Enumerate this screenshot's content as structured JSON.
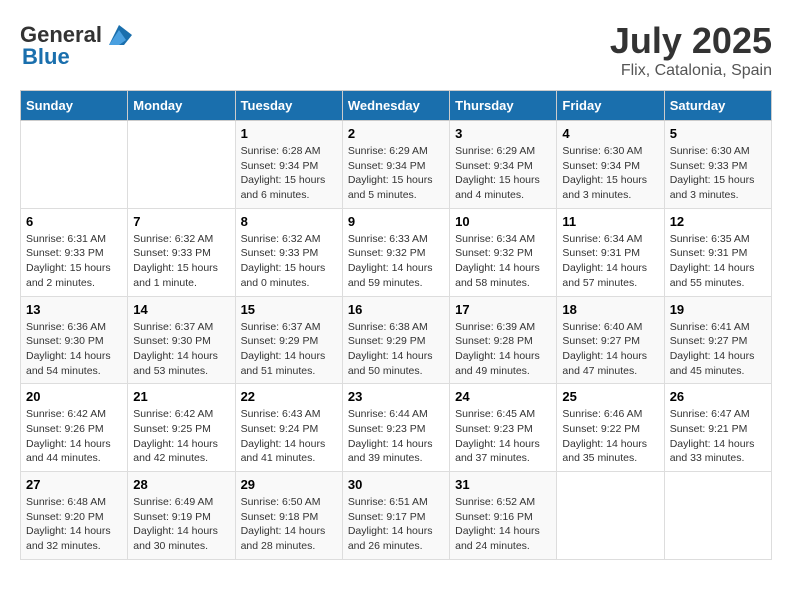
{
  "header": {
    "logo_general": "General",
    "logo_blue": "Blue",
    "title": "July 2025",
    "subtitle": "Flix, Catalonia, Spain"
  },
  "days_of_week": [
    "Sunday",
    "Monday",
    "Tuesday",
    "Wednesday",
    "Thursday",
    "Friday",
    "Saturday"
  ],
  "weeks": [
    [
      {
        "day": "",
        "sunrise": "",
        "sunset": "",
        "daylight": ""
      },
      {
        "day": "",
        "sunrise": "",
        "sunset": "",
        "daylight": ""
      },
      {
        "day": "1",
        "sunrise": "Sunrise: 6:28 AM",
        "sunset": "Sunset: 9:34 PM",
        "daylight": "Daylight: 15 hours and 6 minutes."
      },
      {
        "day": "2",
        "sunrise": "Sunrise: 6:29 AM",
        "sunset": "Sunset: 9:34 PM",
        "daylight": "Daylight: 15 hours and 5 minutes."
      },
      {
        "day": "3",
        "sunrise": "Sunrise: 6:29 AM",
        "sunset": "Sunset: 9:34 PM",
        "daylight": "Daylight: 15 hours and 4 minutes."
      },
      {
        "day": "4",
        "sunrise": "Sunrise: 6:30 AM",
        "sunset": "Sunset: 9:34 PM",
        "daylight": "Daylight: 15 hours and 3 minutes."
      },
      {
        "day": "5",
        "sunrise": "Sunrise: 6:30 AM",
        "sunset": "Sunset: 9:33 PM",
        "daylight": "Daylight: 15 hours and 3 minutes."
      }
    ],
    [
      {
        "day": "6",
        "sunrise": "Sunrise: 6:31 AM",
        "sunset": "Sunset: 9:33 PM",
        "daylight": "Daylight: 15 hours and 2 minutes."
      },
      {
        "day": "7",
        "sunrise": "Sunrise: 6:32 AM",
        "sunset": "Sunset: 9:33 PM",
        "daylight": "Daylight: 15 hours and 1 minute."
      },
      {
        "day": "8",
        "sunrise": "Sunrise: 6:32 AM",
        "sunset": "Sunset: 9:33 PM",
        "daylight": "Daylight: 15 hours and 0 minutes."
      },
      {
        "day": "9",
        "sunrise": "Sunrise: 6:33 AM",
        "sunset": "Sunset: 9:32 PM",
        "daylight": "Daylight: 14 hours and 59 minutes."
      },
      {
        "day": "10",
        "sunrise": "Sunrise: 6:34 AM",
        "sunset": "Sunset: 9:32 PM",
        "daylight": "Daylight: 14 hours and 58 minutes."
      },
      {
        "day": "11",
        "sunrise": "Sunrise: 6:34 AM",
        "sunset": "Sunset: 9:31 PM",
        "daylight": "Daylight: 14 hours and 57 minutes."
      },
      {
        "day": "12",
        "sunrise": "Sunrise: 6:35 AM",
        "sunset": "Sunset: 9:31 PM",
        "daylight": "Daylight: 14 hours and 55 minutes."
      }
    ],
    [
      {
        "day": "13",
        "sunrise": "Sunrise: 6:36 AM",
        "sunset": "Sunset: 9:30 PM",
        "daylight": "Daylight: 14 hours and 54 minutes."
      },
      {
        "day": "14",
        "sunrise": "Sunrise: 6:37 AM",
        "sunset": "Sunset: 9:30 PM",
        "daylight": "Daylight: 14 hours and 53 minutes."
      },
      {
        "day": "15",
        "sunrise": "Sunrise: 6:37 AM",
        "sunset": "Sunset: 9:29 PM",
        "daylight": "Daylight: 14 hours and 51 minutes."
      },
      {
        "day": "16",
        "sunrise": "Sunrise: 6:38 AM",
        "sunset": "Sunset: 9:29 PM",
        "daylight": "Daylight: 14 hours and 50 minutes."
      },
      {
        "day": "17",
        "sunrise": "Sunrise: 6:39 AM",
        "sunset": "Sunset: 9:28 PM",
        "daylight": "Daylight: 14 hours and 49 minutes."
      },
      {
        "day": "18",
        "sunrise": "Sunrise: 6:40 AM",
        "sunset": "Sunset: 9:27 PM",
        "daylight": "Daylight: 14 hours and 47 minutes."
      },
      {
        "day": "19",
        "sunrise": "Sunrise: 6:41 AM",
        "sunset": "Sunset: 9:27 PM",
        "daylight": "Daylight: 14 hours and 45 minutes."
      }
    ],
    [
      {
        "day": "20",
        "sunrise": "Sunrise: 6:42 AM",
        "sunset": "Sunset: 9:26 PM",
        "daylight": "Daylight: 14 hours and 44 minutes."
      },
      {
        "day": "21",
        "sunrise": "Sunrise: 6:42 AM",
        "sunset": "Sunset: 9:25 PM",
        "daylight": "Daylight: 14 hours and 42 minutes."
      },
      {
        "day": "22",
        "sunrise": "Sunrise: 6:43 AM",
        "sunset": "Sunset: 9:24 PM",
        "daylight": "Daylight: 14 hours and 41 minutes."
      },
      {
        "day": "23",
        "sunrise": "Sunrise: 6:44 AM",
        "sunset": "Sunset: 9:23 PM",
        "daylight": "Daylight: 14 hours and 39 minutes."
      },
      {
        "day": "24",
        "sunrise": "Sunrise: 6:45 AM",
        "sunset": "Sunset: 9:23 PM",
        "daylight": "Daylight: 14 hours and 37 minutes."
      },
      {
        "day": "25",
        "sunrise": "Sunrise: 6:46 AM",
        "sunset": "Sunset: 9:22 PM",
        "daylight": "Daylight: 14 hours and 35 minutes."
      },
      {
        "day": "26",
        "sunrise": "Sunrise: 6:47 AM",
        "sunset": "Sunset: 9:21 PM",
        "daylight": "Daylight: 14 hours and 33 minutes."
      }
    ],
    [
      {
        "day": "27",
        "sunrise": "Sunrise: 6:48 AM",
        "sunset": "Sunset: 9:20 PM",
        "daylight": "Daylight: 14 hours and 32 minutes."
      },
      {
        "day": "28",
        "sunrise": "Sunrise: 6:49 AM",
        "sunset": "Sunset: 9:19 PM",
        "daylight": "Daylight: 14 hours and 30 minutes."
      },
      {
        "day": "29",
        "sunrise": "Sunrise: 6:50 AM",
        "sunset": "Sunset: 9:18 PM",
        "daylight": "Daylight: 14 hours and 28 minutes."
      },
      {
        "day": "30",
        "sunrise": "Sunrise: 6:51 AM",
        "sunset": "Sunset: 9:17 PM",
        "daylight": "Daylight: 14 hours and 26 minutes."
      },
      {
        "day": "31",
        "sunrise": "Sunrise: 6:52 AM",
        "sunset": "Sunset: 9:16 PM",
        "daylight": "Daylight: 14 hours and 24 minutes."
      },
      {
        "day": "",
        "sunrise": "",
        "sunset": "",
        "daylight": ""
      },
      {
        "day": "",
        "sunrise": "",
        "sunset": "",
        "daylight": ""
      }
    ]
  ]
}
